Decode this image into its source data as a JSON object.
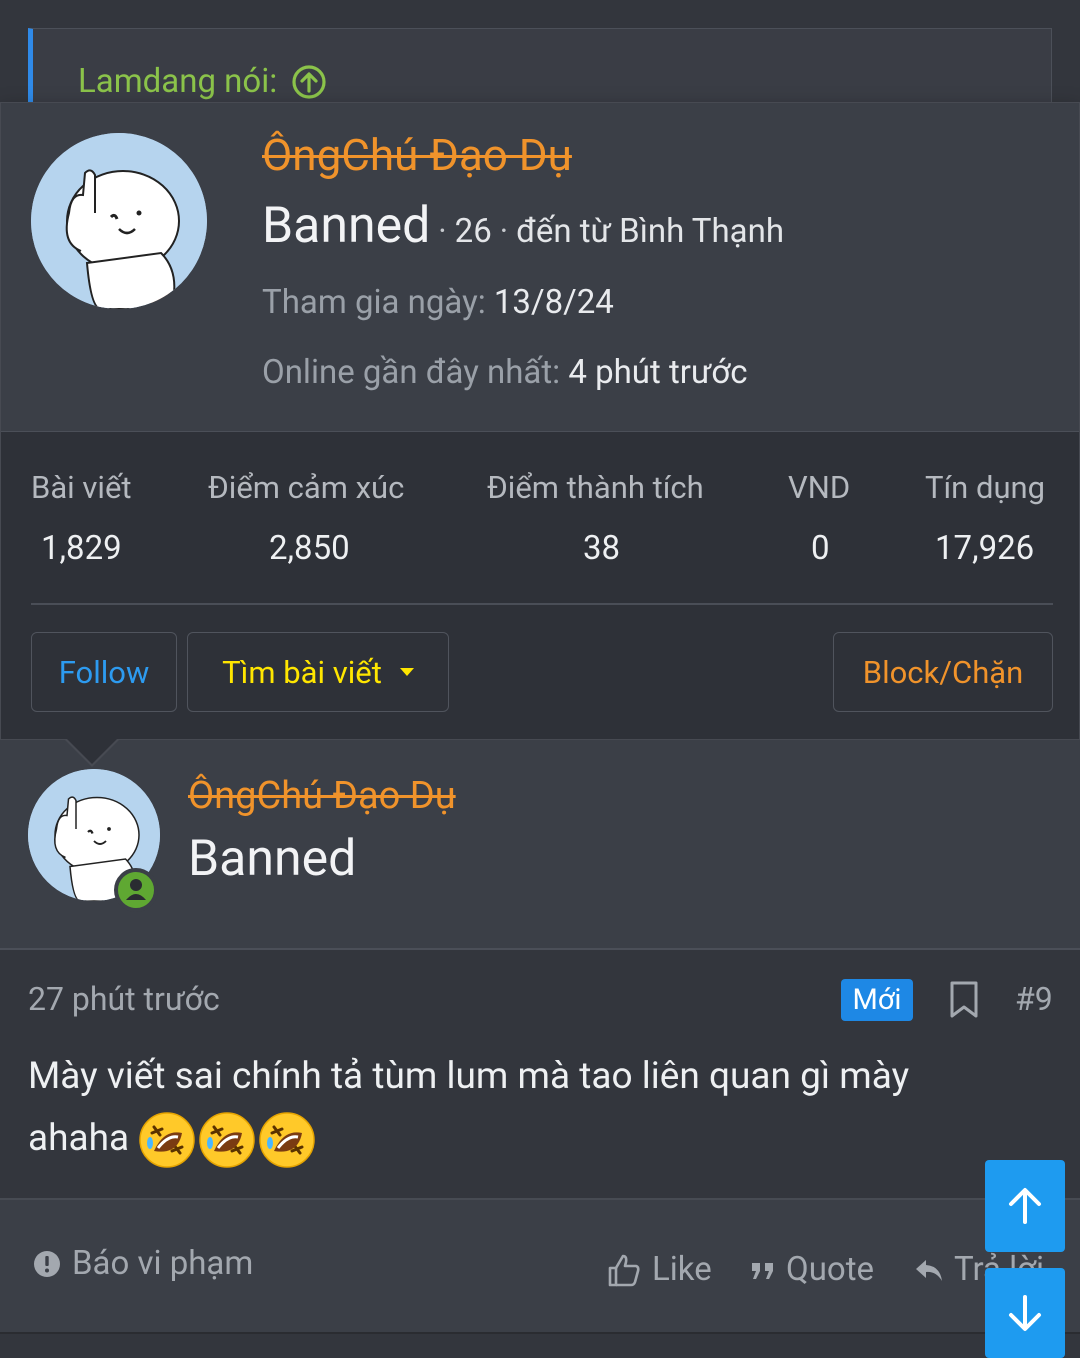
{
  "quote": {
    "attribution": "Lamdang nói:",
    "icon": "arrow-circle-up-icon"
  },
  "popup": {
    "username": "ÔngChú Đạo Dụ",
    "title": "Banned",
    "age": "26",
    "location": "đến từ Bình Thạnh",
    "joined_label": "Tham gia ngày:",
    "joined_value": "13/8/24",
    "online_label": "Online gần đây nhất:",
    "online_value": "4 phút trước",
    "stats": [
      {
        "label": "Bài viết",
        "value": "1,829"
      },
      {
        "label": "Điểm cảm xúc",
        "value": "2,850"
      },
      {
        "label": "Điểm thành tích",
        "value": "38"
      },
      {
        "label": "VND",
        "value": "0"
      },
      {
        "label": "Tín dụng",
        "value": "17,926"
      }
    ],
    "buttons": {
      "follow": "Follow",
      "find_posts": "Tìm bài viết",
      "block": "Block/Chặn"
    }
  },
  "post": {
    "username": "ÔngChú Đạo Dụ",
    "title": "Banned",
    "time": "27 phút trước",
    "new_badge": "Mới",
    "number": "#9",
    "text_line1": "Mày viết sai chính tả tùm lum mà tao liên quan gì mày",
    "text_line2": "ahaha",
    "emojis": [
      "rolling-laughing-emoji",
      "rolling-laughing-emoji",
      "rolling-laughing-emoji"
    ],
    "actions": {
      "report": "Báo vi phạm",
      "like": "Like",
      "quote": "Quote",
      "reply": "Trả lời"
    }
  },
  "colors": {
    "accent_blue": "#1e9bf0",
    "username_orange": "#f0932b",
    "quote_green": "#8bc34a",
    "find_yellow": "#ffe600"
  }
}
